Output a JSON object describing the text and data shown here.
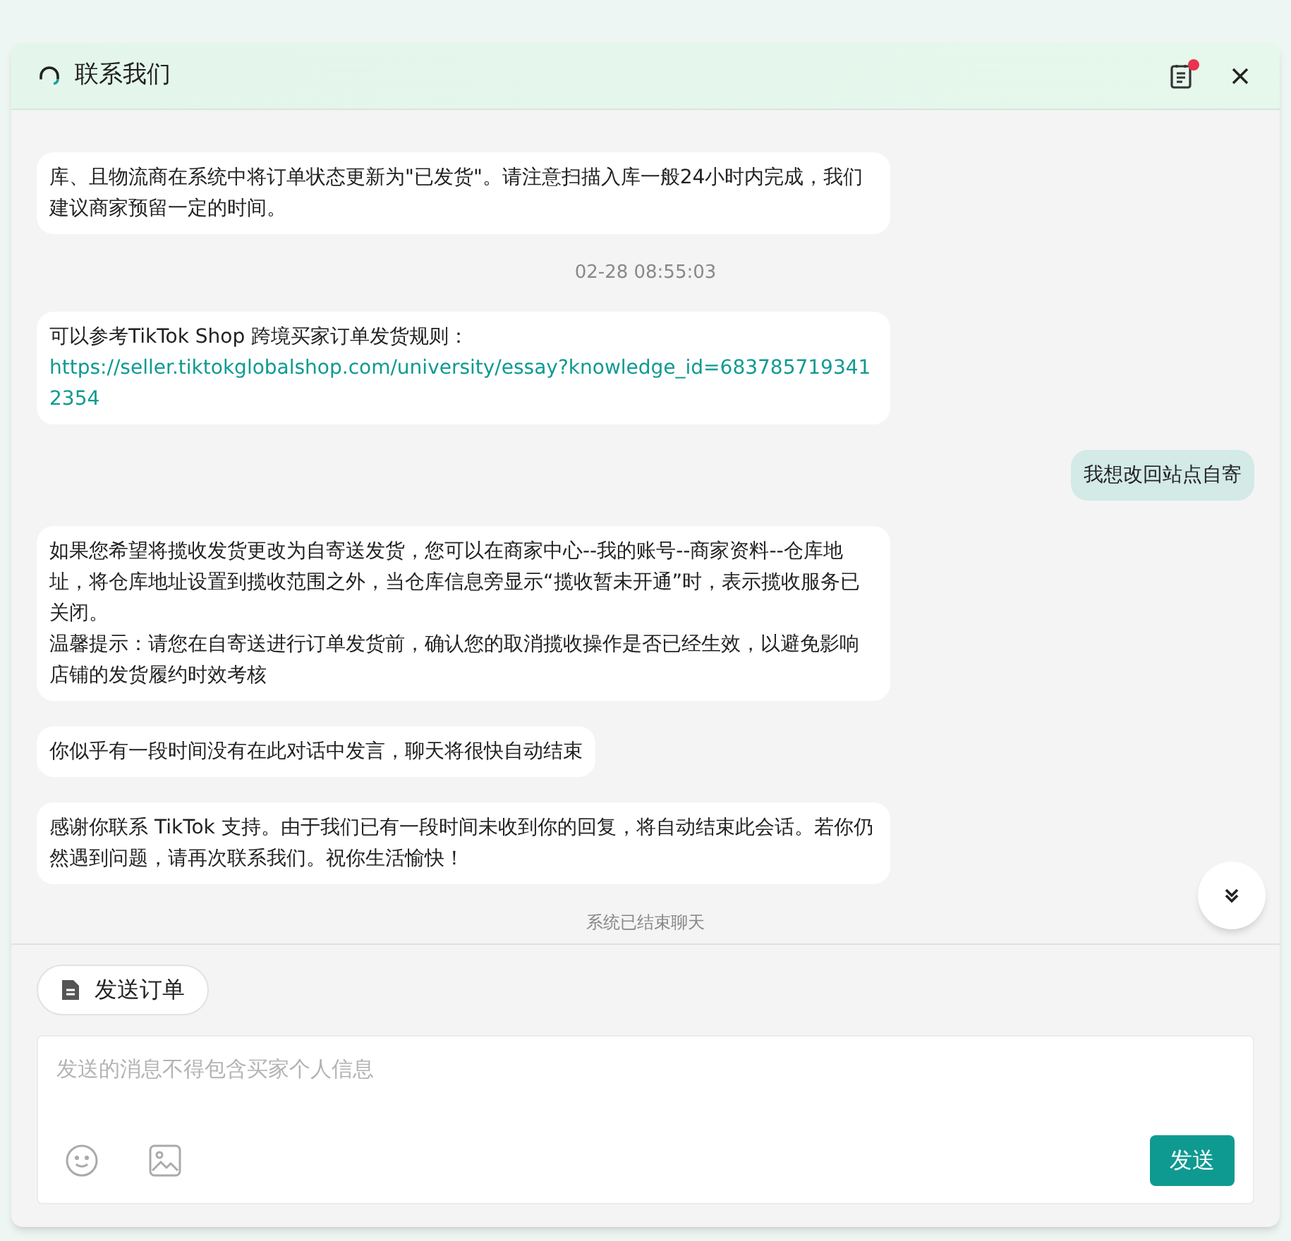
{
  "window": {
    "title": "联系我们",
    "notes_badge": true
  },
  "messages": [
    {
      "kind": "agent",
      "paragraphs": [
        "库、且物流商在系统中将订单状态更新为\"已发货\"。请注意扫描入库一般24小时内完成，我们建议商家预留一定的时间。"
      ]
    },
    {
      "kind": "time",
      "text": "02-28 08:55:03"
    },
    {
      "kind": "agent",
      "paragraphs": [
        "可以参考TikTok Shop 跨境买家订单发货规则："
      ],
      "link": "https://seller.tiktokglobalshop.com/university/essay?knowledge_id=6837857193412354"
    },
    {
      "kind": "user",
      "text": "我想改回站点自寄"
    },
    {
      "kind": "agent",
      "paragraphs": [
        "如果您希望将揽收发货更改为自寄送发货，您可以在商家中心--我的账号--商家资料--仓库地址，将仓库地址设置到揽收范围之外，当仓库信息旁显示“揽收暂未开通”时，表示揽收服务已关闭。",
        "温馨提示：请您在自寄送进行订单发货前，确认您的取消揽收操作是否已经生效，以避免影响店铺的发货履约时效考核"
      ]
    },
    {
      "kind": "agent",
      "paragraphs": [
        "你似乎有一段时间没有在此对话中发言，聊天将很快自动结束"
      ]
    },
    {
      "kind": "agent",
      "paragraphs": [
        "感谢你联系 TikTok 支持。由于我们已有一段时间未收到你的回复，将自动结束此会话。若你仍然遇到问题，请再次联系我们。祝你生活愉快！"
      ]
    },
    {
      "kind": "system",
      "text": "系统已结束聊天"
    }
  ],
  "send_order_button": "发送订单",
  "composer": {
    "placeholder": "发送的消息不得包含买家个人信息",
    "send_button": "发送"
  }
}
